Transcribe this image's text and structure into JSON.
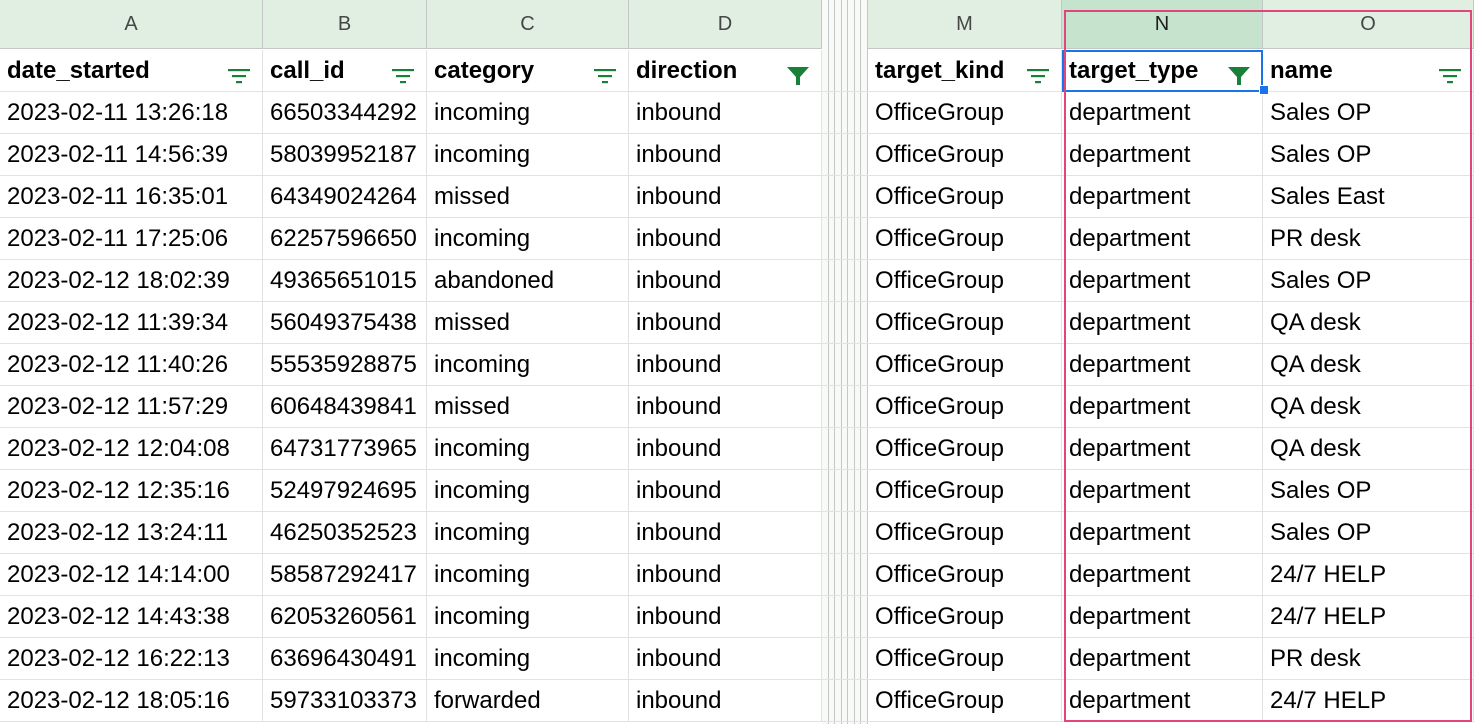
{
  "columns": [
    "A",
    "B",
    "C",
    "D",
    "M",
    "N",
    "O"
  ],
  "headers": [
    "date_started",
    "call_id",
    "category",
    "direction",
    "target_kind",
    "target_type",
    "name"
  ],
  "filter_active": [
    false,
    false,
    false,
    true,
    false,
    true,
    false
  ],
  "rows": [
    [
      "2023-02-11 13:26:18",
      "66503344292",
      "incoming",
      "inbound",
      "OfficeGroup",
      "department",
      "Sales OP"
    ],
    [
      "2023-02-11 14:56:39",
      "58039952187",
      "incoming",
      "inbound",
      "OfficeGroup",
      "department",
      "Sales OP"
    ],
    [
      "2023-02-11 16:35:01",
      "64349024264",
      "missed",
      "inbound",
      "OfficeGroup",
      "department",
      "Sales East"
    ],
    [
      "2023-02-11 17:25:06",
      "62257596650",
      "incoming",
      "inbound",
      "OfficeGroup",
      "department",
      "PR desk"
    ],
    [
      "2023-02-12 18:02:39",
      "49365651015",
      "abandoned",
      "inbound",
      "OfficeGroup",
      "department",
      "Sales OP"
    ],
    [
      "2023-02-12 11:39:34",
      "56049375438",
      "missed",
      "inbound",
      "OfficeGroup",
      "department",
      "QA desk"
    ],
    [
      "2023-02-12 11:40:26",
      "55535928875",
      "incoming",
      "inbound",
      "OfficeGroup",
      "department",
      "QA desk"
    ],
    [
      "2023-02-12 11:57:29",
      "60648439841",
      "missed",
      "inbound",
      "OfficeGroup",
      "department",
      "QA desk"
    ],
    [
      "2023-02-12 12:04:08",
      "64731773965",
      "incoming",
      "inbound",
      "OfficeGroup",
      "department",
      "QA desk"
    ],
    [
      "2023-02-12 12:35:16",
      "52497924695",
      "incoming",
      "inbound",
      "OfficeGroup",
      "department",
      "Sales OP"
    ],
    [
      "2023-02-12 13:24:11",
      "46250352523",
      "incoming",
      "inbound",
      "OfficeGroup",
      "department",
      "Sales OP"
    ],
    [
      "2023-02-12 14:14:00",
      "58587292417",
      "incoming",
      "inbound",
      "OfficeGroup",
      "department",
      "24/7 HELP"
    ],
    [
      "2023-02-12 14:43:38",
      "62053260561",
      "incoming",
      "inbound",
      "OfficeGroup",
      "department",
      "24/7 HELP"
    ],
    [
      "2023-02-12 16:22:13",
      "63696430491",
      "incoming",
      "inbound",
      "OfficeGroup",
      "department",
      "PR desk"
    ],
    [
      "2023-02-12 18:05:16",
      "59733103373",
      "forwarded",
      "inbound",
      "OfficeGroup",
      "department",
      "24/7 HELP"
    ]
  ],
  "colors": {
    "filter_icon": "#188038",
    "selection": "#1a73e8",
    "annotation": "#e0467c",
    "header_bg": "#e1efe3"
  }
}
